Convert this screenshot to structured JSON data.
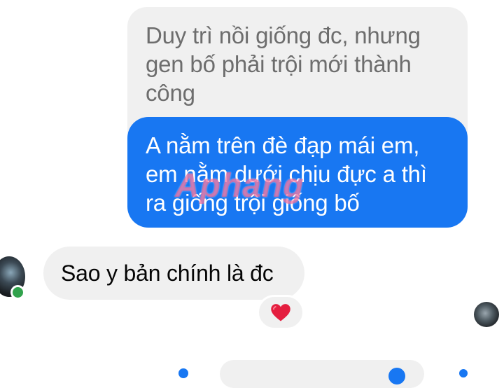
{
  "conversation": {
    "quoted_message": "Duy trì nồi giống đc, nhưng gen bố phải trội mới thành công",
    "sent_message": "A nằm trên đè đạp mái em, em nằm dưới chịu đực a thì ra giống trội giống bố",
    "received_message": "Sao y bản chính là đc",
    "reaction": "heart",
    "watermark": "Aphang"
  },
  "colors": {
    "sent_bubble": "#1877f2",
    "received_bubble": "#f0f0f0",
    "online": "#31a24c",
    "reaction_heart": "#e41e3f"
  },
  "icons": {
    "reaction": "heart-icon",
    "status": "online-dot"
  }
}
